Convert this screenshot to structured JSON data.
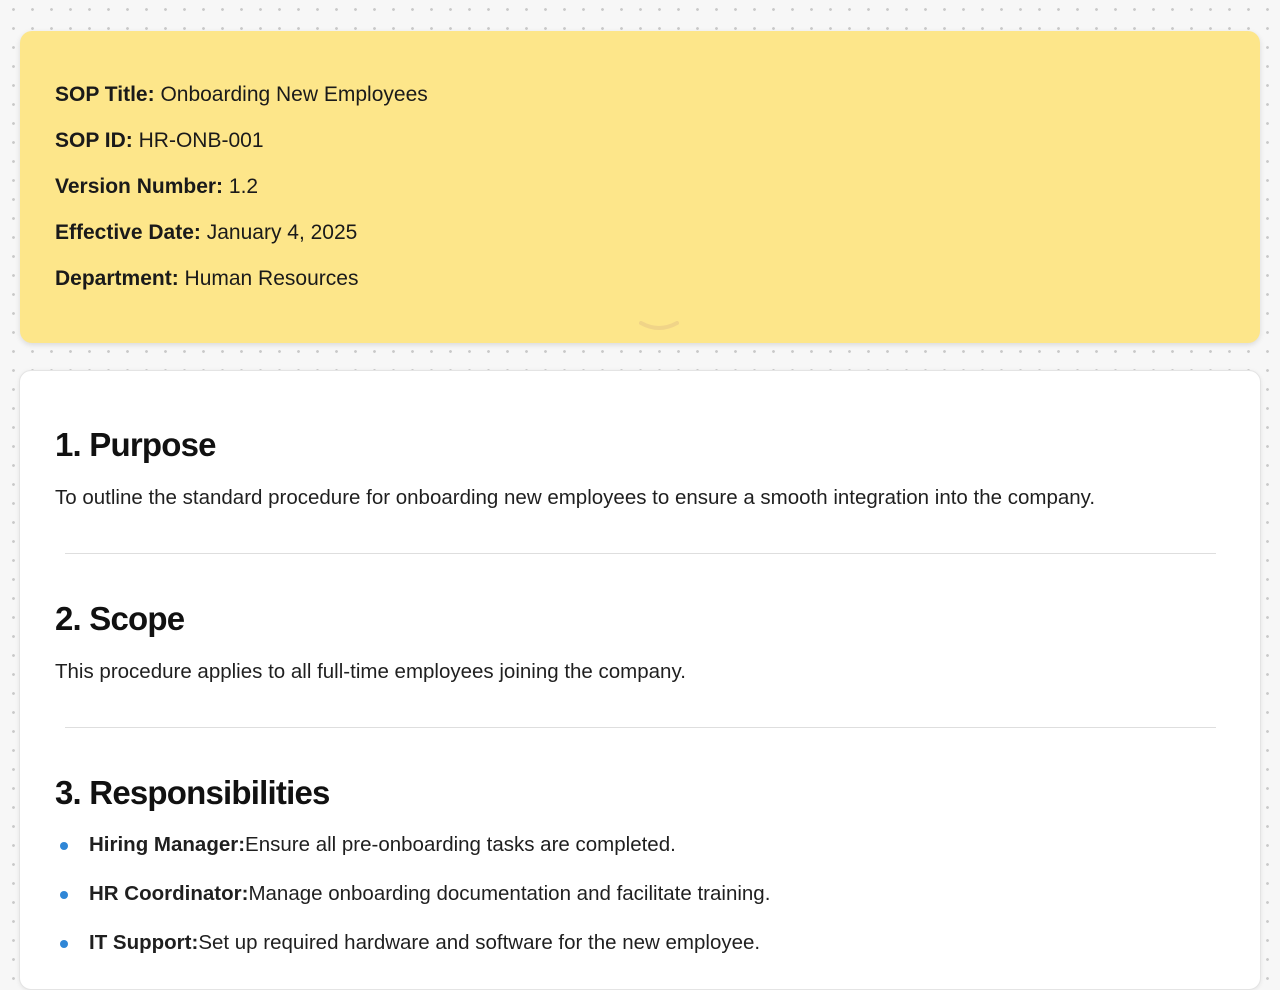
{
  "sop_info": {
    "fields": [
      {
        "label": "SOP Title:",
        "value": "Onboarding New Employees"
      },
      {
        "label": "SOP ID:",
        "value": "HR-ONB-001"
      },
      {
        "label": "Version Number:",
        "value": "1.2"
      },
      {
        "label": "Effective Date:",
        "value": "January 4, 2025"
      },
      {
        "label": "Department:",
        "value": "Human Resources"
      }
    ],
    "collapse_icon": "chevron-down-icon",
    "background_color": "#fde68a"
  },
  "sections": {
    "purpose": {
      "heading": "1. Purpose",
      "text": "To outline the standard procedure for onboarding new employees to ensure a smooth integration into the company."
    },
    "scope": {
      "heading": "2. Scope",
      "text": "This procedure applies to all full-time employees joining the company."
    },
    "responsibilities": {
      "heading": "3. Responsibilities",
      "items": [
        {
          "role": "Hiring Manager:",
          "duty": "Ensure all pre-onboarding tasks are completed."
        },
        {
          "role": "HR Coordinator:",
          "duty": "Manage onboarding documentation and facilitate training."
        },
        {
          "role": "IT Support:",
          "duty": "Set up required hardware and software for the new employee."
        }
      ],
      "bullet_color": "#2f86d6"
    }
  }
}
